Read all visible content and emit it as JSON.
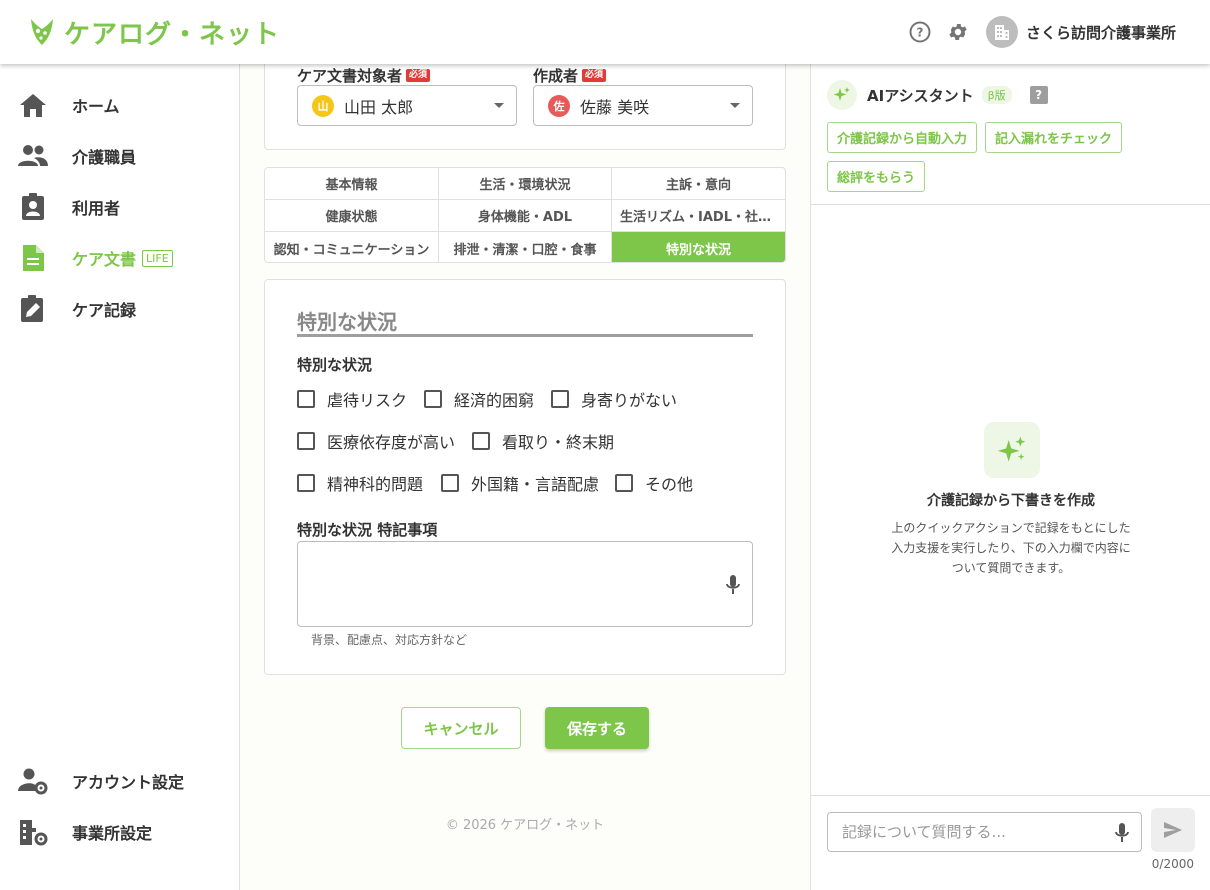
{
  "header": {
    "app_name": "ケアログ・ネット",
    "org_name": "さくら訪問介護事業所",
    "icons": [
      "help-icon",
      "gear-icon",
      "building-icon"
    ]
  },
  "sidebar": {
    "items": [
      {
        "label": "ホーム",
        "icon": "home-icon"
      },
      {
        "label": "介護職員",
        "icon": "people-icon"
      },
      {
        "label": "利用者",
        "icon": "user-badge-icon"
      },
      {
        "label": "ケア文書",
        "icon": "document-icon",
        "badge": "LIFE",
        "active": true
      },
      {
        "label": "ケア記録",
        "icon": "edit-clipboard-icon"
      }
    ],
    "bottom_items": [
      {
        "label": "アカウント設定",
        "icon": "account-settings-icon"
      },
      {
        "label": "事業所設定",
        "icon": "office-settings-icon"
      }
    ]
  },
  "form": {
    "target_label": "ケア文書対象者",
    "author_label": "作成者",
    "required_badge": "必須",
    "target_value": "山田 太郎",
    "target_avatar": "山",
    "author_value": "佐藤 美咲",
    "author_avatar": "佐"
  },
  "tabs": [
    "基本情報",
    "生活・環境状況",
    "主訴・意向",
    "健康状態",
    "身体機能・ADL",
    "生活リズム・IADL・社会参加",
    "認知・コミュニケーション",
    "排泄・清潔・口腔・食事",
    "特別な状況"
  ],
  "active_tab": "特別な状況",
  "section": {
    "title": "特別な状況",
    "group_label": "特別な状況",
    "checkboxes": [
      "虐待リスク",
      "経済的困窮",
      "身寄りがない",
      "医療依存度が高い",
      "看取り・終末期",
      "精神科的問題",
      "外国籍・言語配慮",
      "その他"
    ],
    "notes_label": "特別な状況 特記事項",
    "notes_helper": "背景、配慮点、対応方針など"
  },
  "actions": {
    "cancel": "キャンセル",
    "save": "保存する"
  },
  "footer": "© 2026 ケアログ・ネット",
  "ai": {
    "title": "AIアシスタント",
    "beta": "β版",
    "help": "?",
    "quick_actions": [
      "介護記録から自動入力",
      "記入漏れをチェック",
      "総評をもらう"
    ],
    "empty_title": "介護記録から下書きを作成",
    "empty_desc": "上のクイックアクションで記録をもとにした入力支援を実行したり、下の入力欄で内容について質問できます。",
    "input_placeholder": "記録について質問する...",
    "counter": "0/2000"
  },
  "colors": {
    "accent": "#7dc649",
    "required": "#e53935",
    "target_avatar": "#f5c518",
    "author_avatar": "#e85a5a"
  }
}
